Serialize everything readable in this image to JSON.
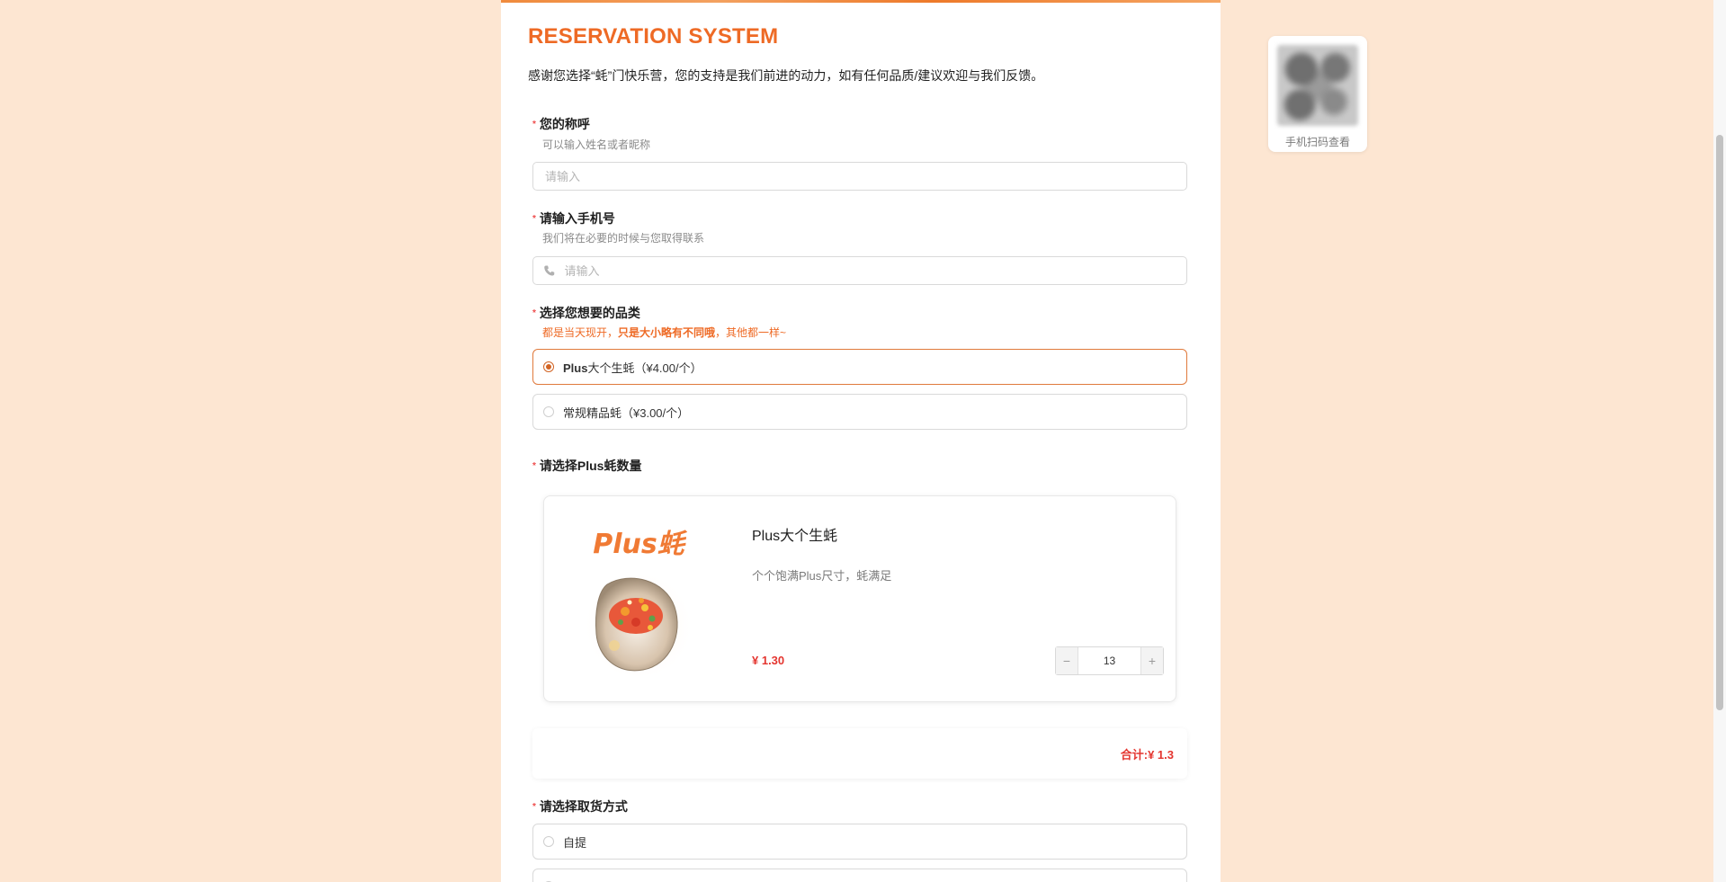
{
  "header": {
    "title": "RESERVATION SYSTEM",
    "subtitle": "感谢您选择“蚝”门快乐营，您的支持是我们前进的动力，如有任何品质/建议欢迎与我们反馈。"
  },
  "fields": {
    "name": {
      "label": "您的称呼",
      "description": "可以输入姓名或者昵称",
      "placeholder": "请输入",
      "value": ""
    },
    "phone": {
      "label": "请输入手机号",
      "description": "我们将在必要的时候与您取得联系",
      "placeholder": "请输入",
      "value": ""
    },
    "category": {
      "label": "选择您想要的品类",
      "description_part1": "都是当天现开，",
      "description_part2": "只是大小略有不同哦",
      "description_part3": "，其他都一样~",
      "options": [
        {
          "label_bold": "Plus",
          "label_rest": "大个生蚝（¥4.00/个）",
          "selected": true
        },
        {
          "label_bold": "",
          "label_rest": "常规精品蚝（¥3.00/个）",
          "selected": false
        }
      ]
    },
    "quantity": {
      "label": "请选择Plus蚝数量"
    },
    "pickup": {
      "label": "请选择取货方式",
      "options": [
        {
          "label": "自提",
          "selected": false
        }
      ]
    }
  },
  "product": {
    "image_text": "Plus蚝",
    "name": "Plus大个生蚝",
    "description": "个个饱满Plus尺寸，蚝满足",
    "price": "¥ 1.30",
    "quantity": "13",
    "minus_symbol": "−",
    "plus_symbol": "+"
  },
  "total": {
    "text": "合计:¥ 1.3"
  },
  "qr": {
    "caption": "手机扫码查看"
  },
  "colors": {
    "background": "#fde6d2",
    "accent": "#ee6a25",
    "price": "#e4352f",
    "radio_selected": "#d26424"
  },
  "icons": {
    "phone": "phone-icon",
    "radio": "radio-icon",
    "qr": "qr-code-icon"
  }
}
